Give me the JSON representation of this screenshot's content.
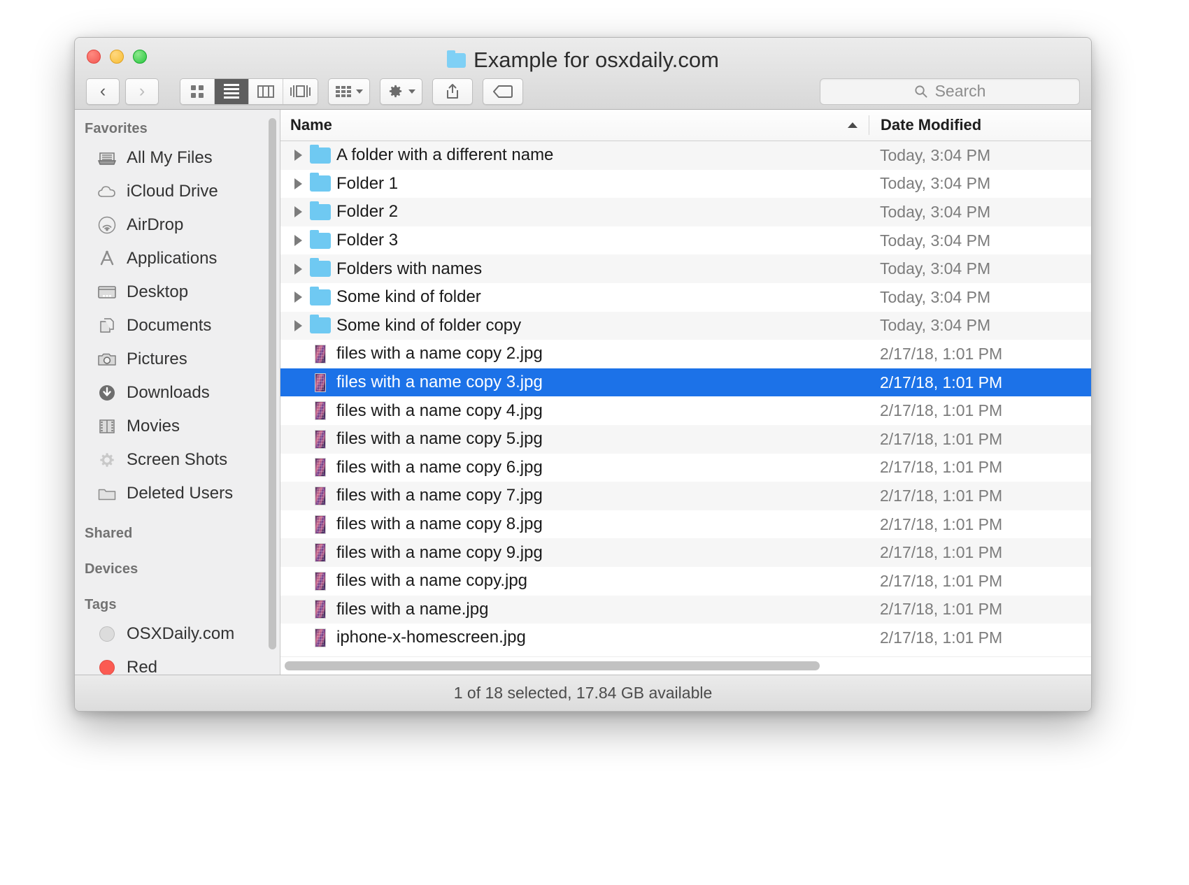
{
  "window": {
    "title": "Example for osxdaily.com",
    "title_icon": "folder-icon",
    "traffic_lights": [
      "close-button",
      "minimize-button",
      "zoom-button"
    ]
  },
  "toolbar": {
    "back_label": "‹",
    "forward_label": "›",
    "view_modes": [
      {
        "name": "icon-view",
        "icon": "grid-icon",
        "active": false
      },
      {
        "name": "list-view",
        "icon": "list-lines-icon",
        "active": true
      },
      {
        "name": "column-view",
        "icon": "columns-icon",
        "active": false
      },
      {
        "name": "coverflow-view",
        "icon": "coverflow-icon",
        "active": false
      }
    ],
    "arrange_icon": "arrange-icon",
    "action_icon": "gear-icon",
    "share_icon": "share-icon",
    "tag_icon": "tag-icon"
  },
  "search": {
    "placeholder": "Search",
    "value": "",
    "icon": "search-icon"
  },
  "sidebar": {
    "sections": [
      {
        "header": "Favorites",
        "items": [
          {
            "label": "All My Files",
            "icon": "all-my-files-icon"
          },
          {
            "label": "iCloud Drive",
            "icon": "cloud-icon"
          },
          {
            "label": "AirDrop",
            "icon": "airdrop-icon"
          },
          {
            "label": "Applications",
            "icon": "applications-icon"
          },
          {
            "label": "Desktop",
            "icon": "desktop-icon"
          },
          {
            "label": "Documents",
            "icon": "documents-icon"
          },
          {
            "label": "Pictures",
            "icon": "camera-icon"
          },
          {
            "label": "Downloads",
            "icon": "download-icon"
          },
          {
            "label": "Movies",
            "icon": "film-icon"
          },
          {
            "label": "Screen Shots",
            "icon": "gear-folder-icon"
          },
          {
            "label": "Deleted Users",
            "icon": "folder-icon"
          }
        ]
      },
      {
        "header": "Shared",
        "items": []
      },
      {
        "header": "Devices",
        "items": []
      },
      {
        "header": "Tags",
        "items": [
          {
            "label": "OSXDaily.com",
            "icon": "tag-dot-grey",
            "color": "#dcdcdc"
          },
          {
            "label": "Red",
            "icon": "tag-dot-red",
            "color": "#fb5b52"
          }
        ]
      }
    ]
  },
  "filelist": {
    "columns": [
      {
        "label": "Name",
        "sorted": true,
        "sort_direction": "ascending"
      },
      {
        "label": "Date Modified",
        "sorted": false
      }
    ],
    "rows": [
      {
        "name": "A folder with a different name",
        "date": "Today, 3:04 PM",
        "type": "folder",
        "selected": false
      },
      {
        "name": "Folder 1",
        "date": "Today, 3:04 PM",
        "type": "folder",
        "selected": false
      },
      {
        "name": "Folder 2",
        "date": "Today, 3:04 PM",
        "type": "folder",
        "selected": false
      },
      {
        "name": "Folder 3",
        "date": "Today, 3:04 PM",
        "type": "folder",
        "selected": false
      },
      {
        "name": "Folders with names",
        "date": "Today, 3:04 PM",
        "type": "folder",
        "selected": false
      },
      {
        "name": "Some kind of folder",
        "date": "Today, 3:04 PM",
        "type": "folder",
        "selected": false
      },
      {
        "name": "Some kind of folder copy",
        "date": "Today, 3:04 PM",
        "type": "folder",
        "selected": false
      },
      {
        "name": "files with a name copy 2.jpg",
        "date": "2/17/18, 1:01 PM",
        "type": "jpg",
        "selected": false
      },
      {
        "name": "files with a name copy 3.jpg",
        "date": "2/17/18, 1:01 PM",
        "type": "jpg",
        "selected": true
      },
      {
        "name": "files with a name copy 4.jpg",
        "date": "2/17/18, 1:01 PM",
        "type": "jpg",
        "selected": false
      },
      {
        "name": "files with a name copy 5.jpg",
        "date": "2/17/18, 1:01 PM",
        "type": "jpg",
        "selected": false
      },
      {
        "name": "files with a name copy 6.jpg",
        "date": "2/17/18, 1:01 PM",
        "type": "jpg",
        "selected": false
      },
      {
        "name": "files with a name copy 7.jpg",
        "date": "2/17/18, 1:01 PM",
        "type": "jpg",
        "selected": false
      },
      {
        "name": "files with a name copy 8.jpg",
        "date": "2/17/18, 1:01 PM",
        "type": "jpg",
        "selected": false
      },
      {
        "name": "files with a name copy 9.jpg",
        "date": "2/17/18, 1:01 PM",
        "type": "jpg",
        "selected": false
      },
      {
        "name": "files with a name copy.jpg",
        "date": "2/17/18, 1:01 PM",
        "type": "jpg",
        "selected": false
      },
      {
        "name": "files with a name.jpg",
        "date": "2/17/18, 1:01 PM",
        "type": "jpg",
        "selected": false
      },
      {
        "name": "iphone-x-homescreen.jpg",
        "date": "2/17/18, 1:01 PM",
        "type": "jpg",
        "selected": false
      }
    ]
  },
  "status": {
    "text": "1 of 18 selected, 17.84 GB available"
  },
  "colors": {
    "selection_blue": "#1c72e8",
    "folder_blue": "#6fc9f2",
    "tag_red": "#fb5b52",
    "window_chrome": "#ececec"
  }
}
